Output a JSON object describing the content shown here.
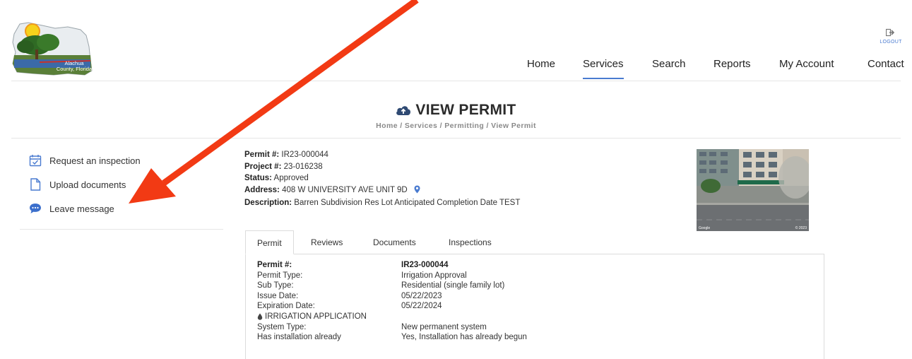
{
  "header": {
    "logo_text": "Alachua County, Florida",
    "logout_label": "LOGOUT",
    "nav": [
      {
        "label": "Home",
        "active": false
      },
      {
        "label": "Services",
        "active": true
      },
      {
        "label": "Search",
        "active": false
      },
      {
        "label": "Reports",
        "active": false
      },
      {
        "label": "My Account",
        "active": false
      },
      {
        "label": "Contact",
        "active": false
      }
    ]
  },
  "page": {
    "title": "VIEW PERMIT",
    "breadcrumb": "Home / Services / Permitting / View Permit"
  },
  "sidebar": {
    "items": [
      {
        "label": "Request an inspection",
        "icon": "calendar-check-icon"
      },
      {
        "label": "Upload documents",
        "icon": "document-icon"
      },
      {
        "label": "Leave message",
        "icon": "chat-bubble-icon"
      }
    ]
  },
  "summary": {
    "permit_label": "Permit #:",
    "permit_value": "IR23-000044",
    "project_label": "Project #:",
    "project_value": "23-016238",
    "status_label": "Status:",
    "status_value": "Approved",
    "address_label": "Address:",
    "address_value": "408 W UNIVERSITY AVE UNIT 9D",
    "description_label": "Description:",
    "description_value": "Barren Subdivision Res Lot Anticipated Completion Date TEST"
  },
  "tabs": [
    {
      "label": "Permit",
      "active": true
    },
    {
      "label": "Reviews",
      "active": false
    },
    {
      "label": "Documents",
      "active": false
    },
    {
      "label": "Inspections",
      "active": false
    }
  ],
  "details": {
    "rows": [
      {
        "k": "Permit #:",
        "v": "IR23-000044"
      },
      {
        "k": "Permit Type:",
        "v": "Irrigation Approval"
      },
      {
        "k": "Sub Type:",
        "v": "Residential (single family lot)"
      },
      {
        "k": "Issue Date:",
        "v": "05/22/2023"
      },
      {
        "k": "Expiration Date:",
        "v": "05/22/2024"
      }
    ],
    "section_title": "IRRIGATION APPLICATION",
    "section_rows": [
      {
        "k": "System Type:",
        "v": "New permanent system"
      },
      {
        "k": "Has installation already",
        "v": "Yes, Installation has already begun"
      }
    ]
  },
  "photo": {
    "watermark_left": "Google",
    "watermark_right": "© 2023"
  },
  "colors": {
    "accent": "#4a7bd0",
    "annotation_arrow": "#f23a14"
  }
}
